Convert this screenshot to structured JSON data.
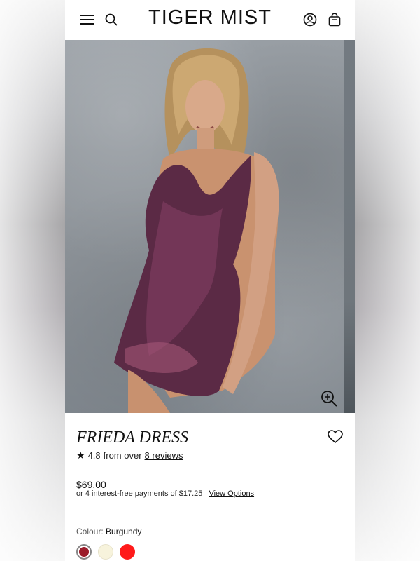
{
  "header": {
    "logo": "TIGER MIST",
    "icons": [
      "menu-icon",
      "search-icon",
      "account-icon",
      "bag-icon"
    ]
  },
  "hero": {
    "image_desc": "model in burgundy floral halter mini dress against concrete wall",
    "zoom_icon": "zoom-in-icon"
  },
  "product": {
    "title": "FRIEDA DRESS",
    "rating": "4.8",
    "rating_text": "from over",
    "reviews_link": "8 reviews",
    "price": "$69.00",
    "installments_text": "or 4 interest-free payments of $17.25",
    "view_options": "View Options",
    "colour_label": "Colour:",
    "colour_value": "Burgundy",
    "swatches": [
      {
        "name": "Burgundy",
        "color": "#9b1c2a",
        "selected": true
      },
      {
        "name": "Cream",
        "color": "#f7f3dc",
        "selected": false
      },
      {
        "name": "Red",
        "color": "#ff1a1a",
        "selected": false
      }
    ]
  },
  "colors": {
    "text": "#111111",
    "background": "#ffffff"
  }
}
